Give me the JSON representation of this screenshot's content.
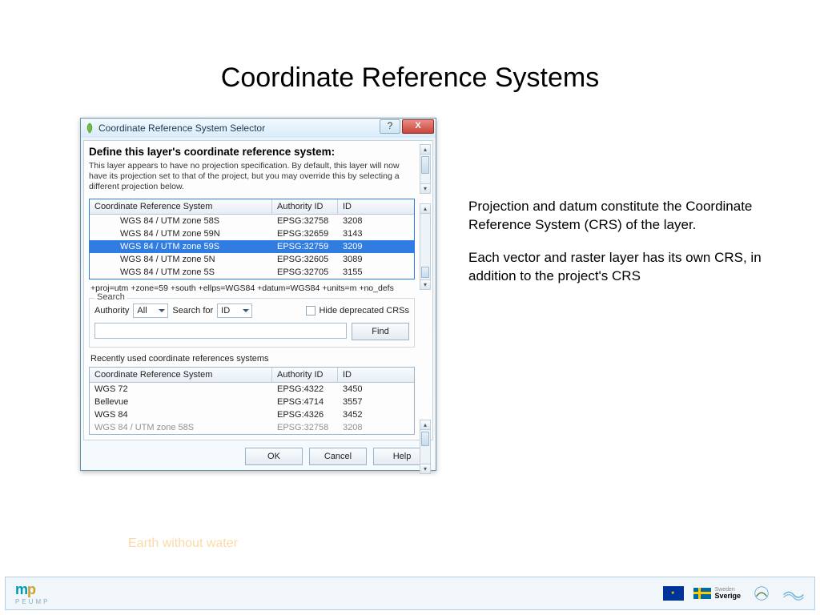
{
  "slide": {
    "title": "Coordinate Reference Systems",
    "watermark": "Earth without water"
  },
  "side": {
    "p1": "Projection and datum constitute the Coordinate Reference System (CRS) of the layer.",
    "p2": "Each vector and raster layer has its own CRS, in addition to the project's CRS"
  },
  "dialog": {
    "title": "Coordinate Reference System Selector",
    "heading": "Define this layer's coordinate reference system:",
    "desc": "This layer appears to have no projection specification. By default, this layer will now have its projection set to that of the project, but you may override this by selecting a different projection below.",
    "cols": {
      "crs": "Coordinate Reference System",
      "auth": "Authority ID",
      "id": "ID"
    },
    "rows": [
      {
        "crs": "WGS 84 / UTM zone 58S",
        "auth": "EPSG:32758",
        "id": "3208"
      },
      {
        "crs": "WGS 84 / UTM zone 59N",
        "auth": "EPSG:32659",
        "id": "3143"
      },
      {
        "crs": "WGS 84 / UTM zone 59S",
        "auth": "EPSG:32759",
        "id": "3209"
      },
      {
        "crs": "WGS 84 / UTM zone 5N",
        "auth": "EPSG:32605",
        "id": "3089"
      },
      {
        "crs": "WGS 84 / UTM zone 5S",
        "auth": "EPSG:32705",
        "id": "3155"
      }
    ],
    "proj": "+proj=utm +zone=59 +south +ellps=WGS84 +datum=WGS84 +units=m +no_defs",
    "search": {
      "group": "Search",
      "authority_label": "Authority",
      "authority_value": "All",
      "searchfor_label": "Search for",
      "searchfor_value": "ID",
      "hide": "Hide deprecated CRSs",
      "find": "Find"
    },
    "recent_label": "Recently used coordinate references systems",
    "recent": [
      {
        "crs": "WGS 72",
        "auth": "EPSG:4322",
        "id": "3450"
      },
      {
        "crs": "Bellevue",
        "auth": "EPSG:4714",
        "id": "3557"
      },
      {
        "crs": "WGS 84",
        "auth": "EPSG:4326",
        "id": "3452"
      },
      {
        "crs": "WGS 84 / UTM zone 58S",
        "auth": "EPSG:32758",
        "id": "3208"
      }
    ],
    "buttons": {
      "ok": "OK",
      "cancel": "Cancel",
      "help": "Help"
    }
  },
  "footer": {
    "sverige_small": "Sweden",
    "sverige": "Sverige"
  }
}
